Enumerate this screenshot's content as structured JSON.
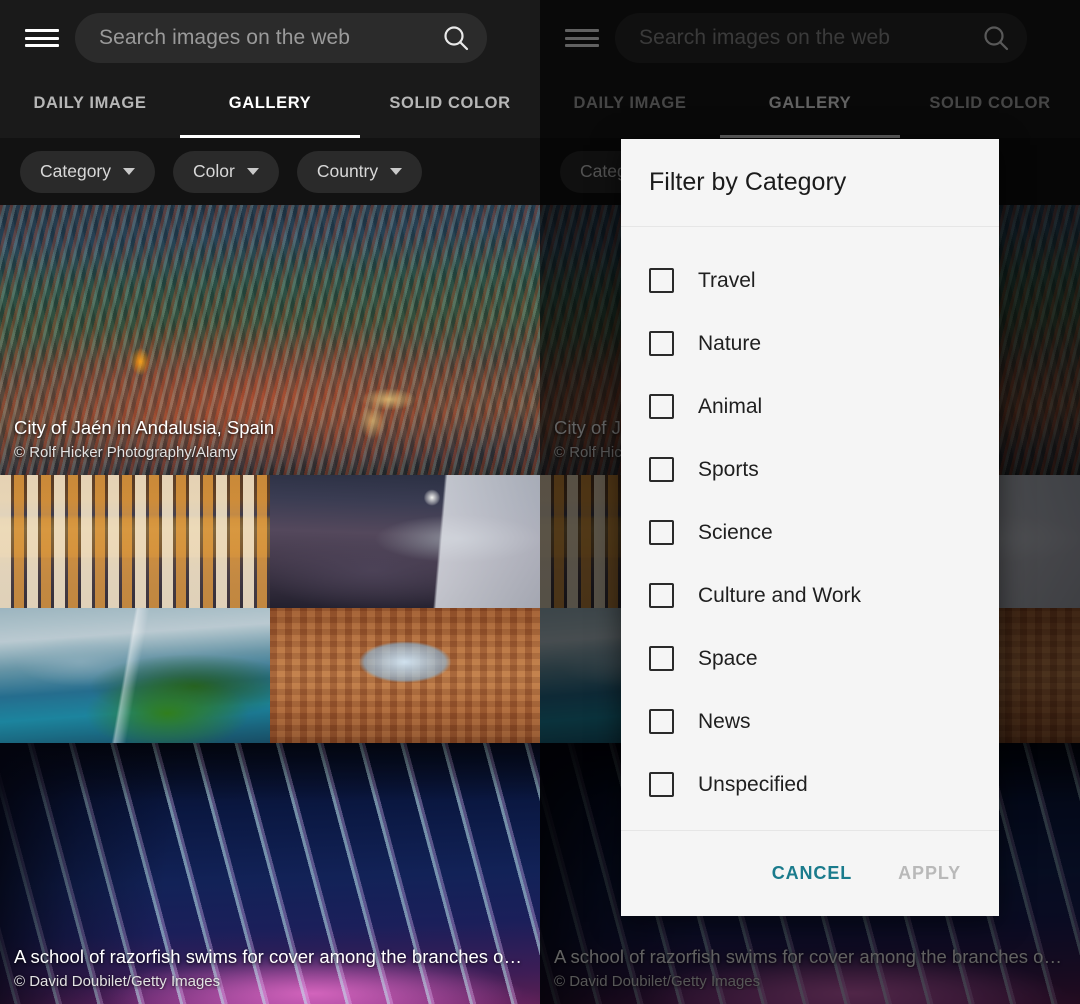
{
  "app": {
    "menu_icon": "hamburger-menu-icon",
    "search": {
      "placeholder": "Search images on the web",
      "icon": "search-icon"
    },
    "tabs": [
      {
        "label": "DAILY IMAGE",
        "active": false
      },
      {
        "label": "GALLERY",
        "active": true
      },
      {
        "label": "SOLID COLOR",
        "active": false
      }
    ],
    "filter_chips": [
      {
        "label": "Category",
        "icon": "chevron-down-icon"
      },
      {
        "label": "Color",
        "icon": "chevron-down-icon"
      },
      {
        "label": "Country",
        "icon": "chevron-down-icon"
      }
    ]
  },
  "gallery": {
    "hero": {
      "title": "City of Jaén in Andalusia, Spain",
      "credit": "©  Rolf Hicker Photography/Alamy"
    },
    "thumbnails": [
      {
        "name": "boat-huts-autumn-reflection"
      },
      {
        "name": "gargoyle-moonlit-sky"
      },
      {
        "name": "green-cliff-waterfall-ocean"
      },
      {
        "name": "courtyard-looking-up-sky"
      }
    ],
    "bottom": {
      "title": "A school of razorfish swims for cover among the branches o…",
      "credit": "©  David Doubilet/Getty Images"
    }
  },
  "dialog": {
    "title": "Filter by Category",
    "options": [
      {
        "label": "Travel",
        "checked": false
      },
      {
        "label": "Nature",
        "checked": false
      },
      {
        "label": "Animal",
        "checked": false
      },
      {
        "label": "Sports",
        "checked": false
      },
      {
        "label": "Science",
        "checked": false
      },
      {
        "label": "Culture and Work",
        "checked": false
      },
      {
        "label": "Space",
        "checked": false
      },
      {
        "label": "News",
        "checked": false
      },
      {
        "label": "Unspecified",
        "checked": false
      }
    ],
    "cancel_label": "CANCEL",
    "apply_label": "APPLY",
    "cancel_color": "#1a7b8c",
    "apply_color": "#b9b9b9"
  },
  "colors": {
    "appbar_bg": "#1a1a1a",
    "chipbar_bg": "#121212",
    "dialog_bg": "#f5f5f5",
    "accent": "#1a7b8c"
  }
}
